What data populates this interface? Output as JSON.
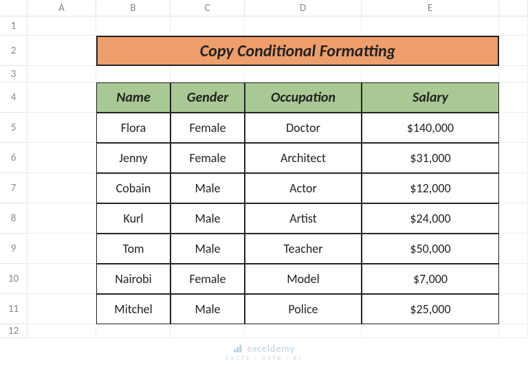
{
  "columns": [
    "A",
    "B",
    "C",
    "D",
    "E"
  ],
  "rows": [
    "1",
    "2",
    "3",
    "4",
    "5",
    "6",
    "7",
    "8",
    "9",
    "10",
    "11",
    "12"
  ],
  "title": "Copy Conditional Formatting",
  "headers": {
    "name": "Name",
    "gender": "Gender",
    "occupation": "Occupation",
    "salary": "Salary"
  },
  "data": [
    {
      "name": "Flora",
      "gender": "Female",
      "occupation": "Doctor",
      "salary": "$140,000"
    },
    {
      "name": "Jenny",
      "gender": "Female",
      "occupation": "Architect",
      "salary": "$31,000"
    },
    {
      "name": "Cobain",
      "gender": "Male",
      "occupation": "Actor",
      "salary": "$12,000"
    },
    {
      "name": "Kurl",
      "gender": "Male",
      "occupation": "Artist",
      "salary": "$24,000"
    },
    {
      "name": "Tom",
      "gender": "Male",
      "occupation": "Teacher",
      "salary": "$50,000"
    },
    {
      "name": "Nairobi",
      "gender": "Female",
      "occupation": "Model",
      "salary": "$7,000"
    },
    {
      "name": "Mitchel",
      "gender": "Male",
      "occupation": "Police",
      "salary": "$25,000"
    }
  ],
  "watermark": {
    "brand": "exceldemy",
    "tagline": "EXCEL · DATA · BI"
  }
}
